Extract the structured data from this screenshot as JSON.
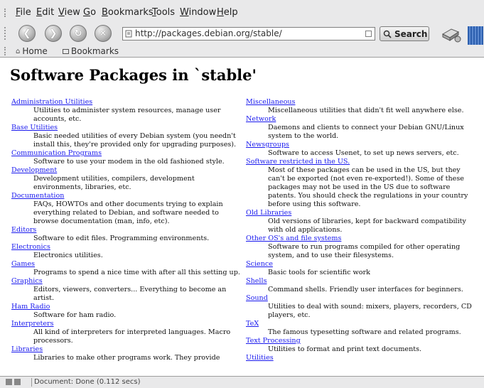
{
  "menubar": {
    "items": [
      "File",
      "Edit",
      "View",
      "Go",
      "Bookmarks",
      "Tools",
      "Window",
      "Help"
    ]
  },
  "navbar": {
    "url": "http://packages.debian.org/stable/",
    "search_label": "Search"
  },
  "bookmarks_bar": {
    "home_label": "Home",
    "bookmarks_label": "Bookmarks"
  },
  "page": {
    "title": "Software Packages in `stable'",
    "left_column": [
      {
        "name": "Administration Utilities",
        "desc": "Utilities to administer system resources, manage user accounts, etc."
      },
      {
        "name": "Base Utilities",
        "desc": "Basic needed utilities of every Debian system (you needn't install this, they're provided only for upgrading purposes)."
      },
      {
        "name": "Communication Programs",
        "desc": "Software to use your modem in the old fashioned style."
      },
      {
        "name": "Development",
        "desc": "Development utilities, compilers, development environments, libraries, etc."
      },
      {
        "name": "Documentation",
        "desc": "FAQs, HOWTOs and other documents trying to explain everything related to Debian, and software needed to browse documentation (man, info, etc)."
      },
      {
        "name": "Editors",
        "desc": "Software to edit files. Programming environments."
      },
      {
        "name": "Electronics",
        "desc": "Electronics utilities."
      },
      {
        "name": "Games",
        "desc": "Programs to spend a nice time with after all this setting up."
      },
      {
        "name": "Graphics",
        "desc": "Editors, viewers, converters... Everything to become an artist."
      },
      {
        "name": "Ham Radio",
        "desc": "Software for ham radio."
      },
      {
        "name": "Interpreters",
        "desc": "All kind of interpreters for interpreted languages. Macro processors."
      },
      {
        "name": "Libraries",
        "desc": "Libraries to make other programs work. They provide"
      }
    ],
    "right_column": [
      {
        "name": "Miscellaneous",
        "desc": "Miscellaneous utilities that didn't fit well anywhere else."
      },
      {
        "name": "Network",
        "desc": "Daemons and clients to connect your Debian GNU/Linux system to the world."
      },
      {
        "name": "Newsgroups",
        "desc": "Software to access Usenet, to set up news servers, etc."
      },
      {
        "name": "Software restricted in the US.",
        "desc": "Most of these packages can be used in the US, but they can't be exported (not even re-exported!). Some of these packages may not be used in the US due to software patents. You should check the regulations in your country before using this software."
      },
      {
        "name": "Old Libraries",
        "desc": "Old versions of libraries, kept for backward compatibility with old applications."
      },
      {
        "name": "Other OS's and file systems",
        "desc": "Software to run programs compiled for other operating system, and to use their filesystems."
      },
      {
        "name": "Science",
        "desc": "Basic tools for scientific work"
      },
      {
        "name": "Shells",
        "desc": "Command shells. Friendly user interfaces for beginners."
      },
      {
        "name": "Sound",
        "desc": "Utilities to deal with sound: mixers, players, recorders, CD players, etc."
      },
      {
        "name": "TeX",
        "desc": "The famous typesetting software and related programs."
      },
      {
        "name": "Text Processing",
        "desc": "Utilities to format and print text documents."
      },
      {
        "name": "Utilities",
        "desc": ""
      }
    ]
  },
  "statusbar": {
    "text": "Document: Done (0.112 secs)"
  },
  "colors": {
    "link": "#1a1aee",
    "chrome": "#e9e9ea"
  }
}
